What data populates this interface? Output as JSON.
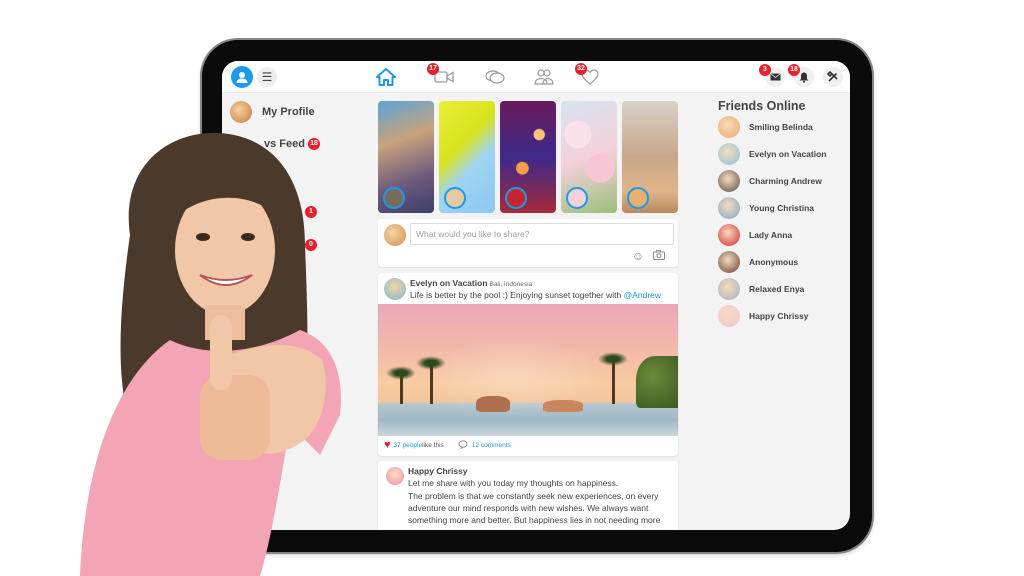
{
  "topbar": {
    "profile_icon": "user-icon",
    "menu_icon": "hamburger-icon",
    "nav": [
      {
        "name": "home",
        "icon": "home-icon",
        "badge": null,
        "active": true
      },
      {
        "name": "videos",
        "icon": "video-camera-icon",
        "badge": "17"
      },
      {
        "name": "messages",
        "icon": "chat-bubbles-icon",
        "badge": null
      },
      {
        "name": "friends",
        "icon": "users-icon",
        "badge": null
      },
      {
        "name": "likes",
        "icon": "heart-icon",
        "badge": "32"
      }
    ],
    "right": [
      {
        "name": "mail",
        "icon": "envelope-icon",
        "badge": "3"
      },
      {
        "name": "notifications",
        "icon": "bell-icon",
        "badge": "18"
      },
      {
        "name": "settings",
        "icon": "tools-icon",
        "badge": null
      }
    ]
  },
  "sidebar": {
    "items": [
      {
        "label": "My Profile",
        "badge": null
      },
      {
        "label": "News Feed",
        "visible_label": "vs Feed",
        "badge": "18"
      },
      {
        "label": "",
        "badge": "1"
      },
      {
        "label": "",
        "badge": "0"
      }
    ]
  },
  "stories": [
    {
      "name": "couple-selfie"
    },
    {
      "name": "palm-leaf"
    },
    {
      "name": "bokeh-lights"
    },
    {
      "name": "cherry-blossom"
    },
    {
      "name": "fitness-beach"
    }
  ],
  "composer": {
    "placeholder": "What would you like to share?",
    "emoji_icon": "smiley-icon",
    "camera_icon": "camera-icon"
  },
  "post": {
    "author": "Evelyn on Vacation",
    "location": "Bali, Indonesia",
    "text": "Life is better by the pool :) Enjoying sunset together with ",
    "mention": "@Andrew",
    "likes_link": "37 people",
    "likes_suffix": " like this",
    "comments": "12 comments"
  },
  "post2": {
    "author": "Happy Chrissy",
    "lines": [
      "Let me share with you today my thoughts on happiness.",
      "The problem is that we constantly seek new experiences, on every",
      "adventure our mind responds with new wishes. We always want",
      "something more and better. But happiness lies in not needing more"
    ]
  },
  "friends": {
    "title": "Friends Online",
    "list": [
      {
        "name": "Smiling Belinda",
        "color": "#e9a860"
      },
      {
        "name": "Evelyn on Vacation",
        "color": "#8cc0d8"
      },
      {
        "name": "Charming Andrew",
        "color": "#5a4a3e"
      },
      {
        "name": "Young Christina",
        "color": "#7aa6c8"
      },
      {
        "name": "Lady Anna",
        "color": "#d9262b"
      },
      {
        "name": "Anonymous",
        "color": "#6a3a2a"
      },
      {
        "name": "Relaxed Enya",
        "color": "#9fb0c0"
      },
      {
        "name": "Happy Chrissy",
        "color": "#f4c6d2"
      }
    ]
  },
  "colors": {
    "accent": "#1a9ae8",
    "badge": "#e8202b",
    "bezel": "#0b0b0b",
    "screen_bg": "#f3f3f3"
  }
}
